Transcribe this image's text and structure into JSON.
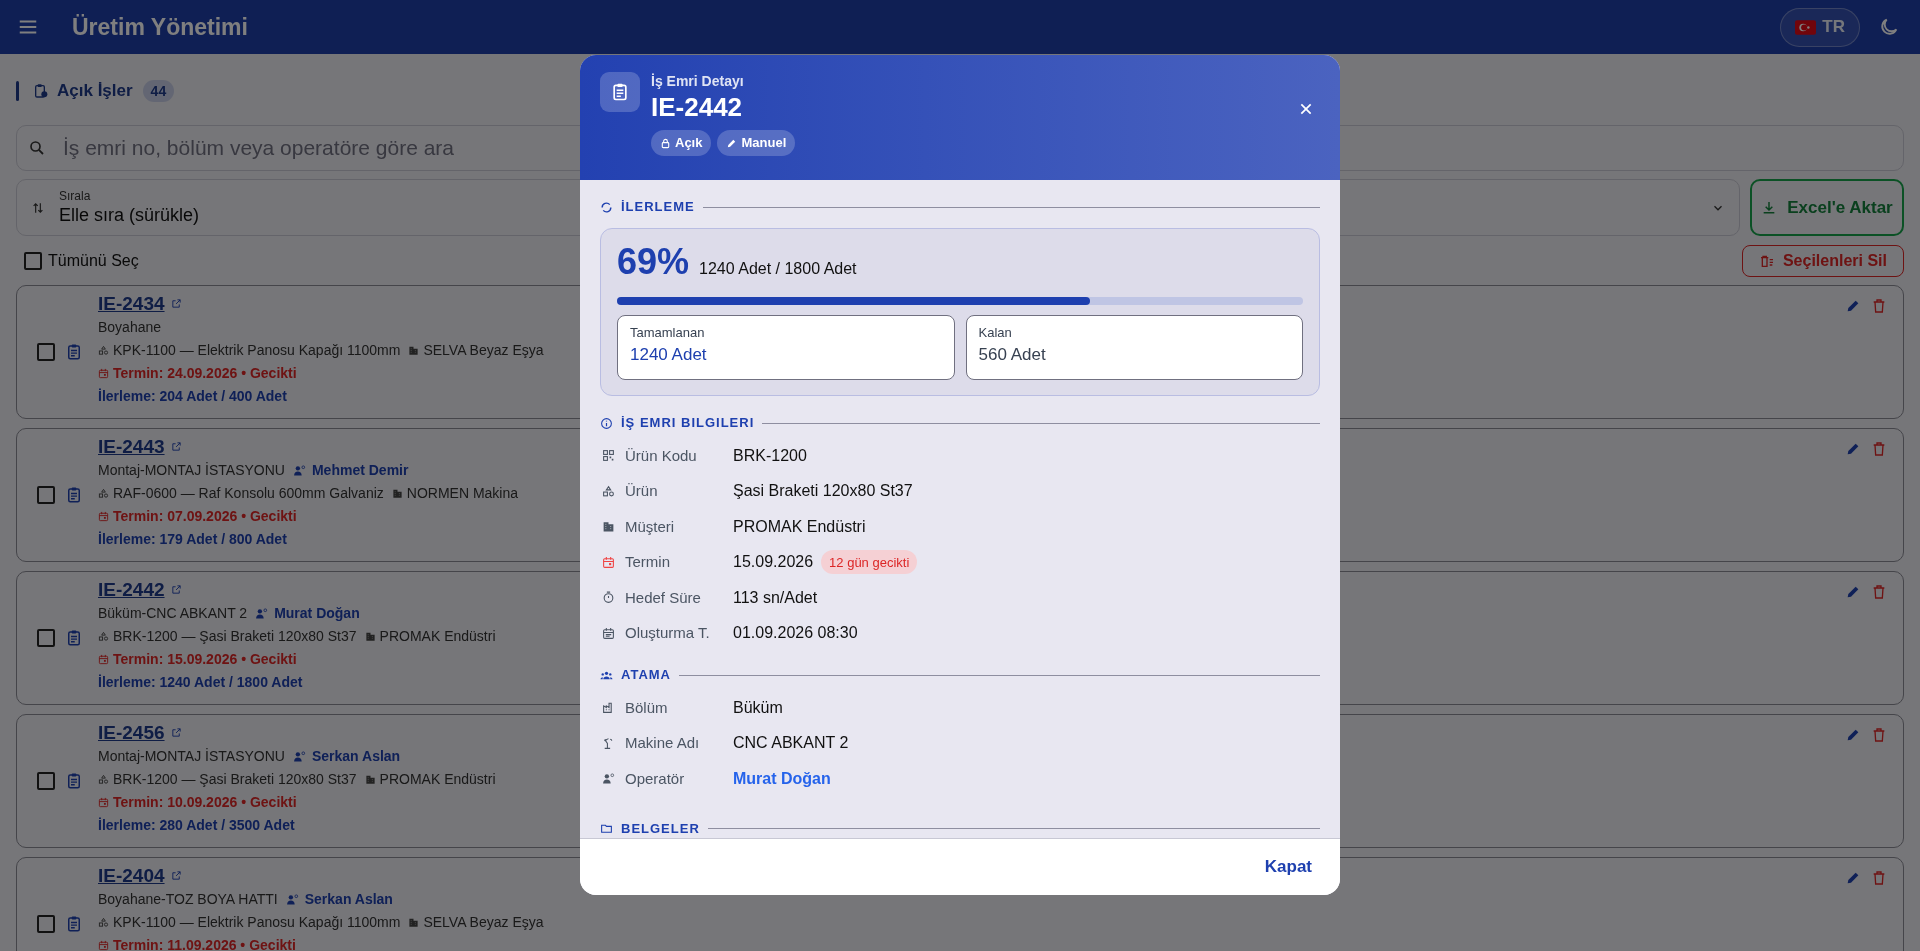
{
  "app_bar": {
    "title": "Üretim Yönetimi",
    "language": "TR"
  },
  "list": {
    "title": "Açık İşler",
    "count": "44",
    "search": {
      "placeholder": "İş emri no, bölüm veya operatöre göre ara"
    },
    "sort": {
      "label": "Sırala",
      "value": "Elle sıra (sürükle)"
    },
    "export_button": "Excel'e Aktar",
    "select_all": {
      "label": "Tümünü Seç",
      "checked": false
    },
    "delete_selected_button": "Seçilenleri Sil",
    "cards": [
      {
        "id": "IE-2434",
        "department": "Boyahane",
        "product": "KPK-1100 — Elektrik Panosu Kapağı 1100mm",
        "customer": "SELVA Beyaz Eşya",
        "due": "Termin: 24.09.2026 • Gecikti",
        "progress": "İlerleme: 204 Adet / 400 Adet",
        "checked": false
      },
      {
        "id": "IE-2443",
        "department": "Montaj-MONTAJ İSTASYONU",
        "operator": "Mehmet Demir",
        "product": "RAF-0600 — Raf Konsolu 600mm Galvaniz",
        "customer": "NORMEN Makina",
        "due": "Termin: 07.09.2026 • Gecikti",
        "progress": "İlerleme: 179 Adet / 800 Adet",
        "checked": false
      },
      {
        "id": "IE-2442",
        "department": "Büküm-CNC ABKANT 2",
        "operator": "Murat Doğan",
        "product": "BRK-1200 — Şasi Braketi 120x80 St37",
        "customer": "PROMAK Endüstri",
        "due": "Termin: 15.09.2026 • Gecikti",
        "progress": "İlerleme: 1240 Adet / 1800 Adet",
        "checked": false
      },
      {
        "id": "IE-2456",
        "department": "Montaj-MONTAJ İSTASYONU",
        "operator": "Serkan Aslan",
        "product": "BRK-1200 — Şasi Braketi 120x80 St37",
        "customer": "PROMAK Endüstri",
        "due": "Termin: 10.09.2026 • Gecikti",
        "progress": "İlerleme: 280 Adet / 3500 Adet",
        "checked": false
      },
      {
        "id": "IE-2404",
        "department": "Boyahane-TOZ BOYA HATTI",
        "operator": "Serkan Aslan",
        "product": "KPK-1100 — Elektrik Panosu Kapağı 1100mm",
        "customer": "SELVA Beyaz Eşya",
        "due": "Termin: 11.09.2026 • Gecikti",
        "checked": false
      }
    ]
  },
  "dialog": {
    "subtitle": "İş Emri Detayı",
    "title": "IE-2442",
    "chips": [
      {
        "kind": "lock",
        "label": "Açık"
      },
      {
        "kind": "pencil",
        "label": "Manuel"
      }
    ],
    "progress": {
      "title": "İLERLEME",
      "percent": "69%",
      "summary": "1240 Adet / 1800 Adet",
      "level": 0.69,
      "stats": [
        {
          "kind": "done",
          "label": "Tamamlanan",
          "value": "1240 Adet"
        },
        {
          "kind": "remaining",
          "label": "Kalan",
          "value": "560 Adet"
        }
      ]
    },
    "info": {
      "title": "İŞ EMRI BILGILERI",
      "rows": [
        {
          "kind": "code",
          "label": "Ürün Kodu",
          "value": "BRK-1200"
        },
        {
          "kind": "product",
          "label": "Ürün",
          "value": "Şasi Braketi 120x80 St37"
        },
        {
          "kind": "customer",
          "label": "Müşteri",
          "value": "PROMAK Endüstri"
        },
        {
          "kind": "due",
          "label": "Termin",
          "value": "15.09.2026",
          "badge": "12 gün gecikti"
        },
        {
          "kind": "timer",
          "label": "Hedef Süre",
          "value": "113 sn/Adet"
        },
        {
          "kind": "created",
          "label": "Oluşturma T.",
          "value": "01.09.2026 08:30"
        }
      ]
    },
    "assignment": {
      "title": "ATAMA",
      "rows": [
        {
          "kind": "department",
          "label": "Bölüm",
          "value": "Büküm"
        },
        {
          "kind": "machine",
          "label": "Makine Adı",
          "value": "CNC ABKANT 2"
        },
        {
          "kind": "operator",
          "label": "Operatör",
          "value": "Murat Doğan"
        }
      ]
    },
    "documents": {
      "title": "BELGELER"
    },
    "close_button": "Kapat"
  }
}
